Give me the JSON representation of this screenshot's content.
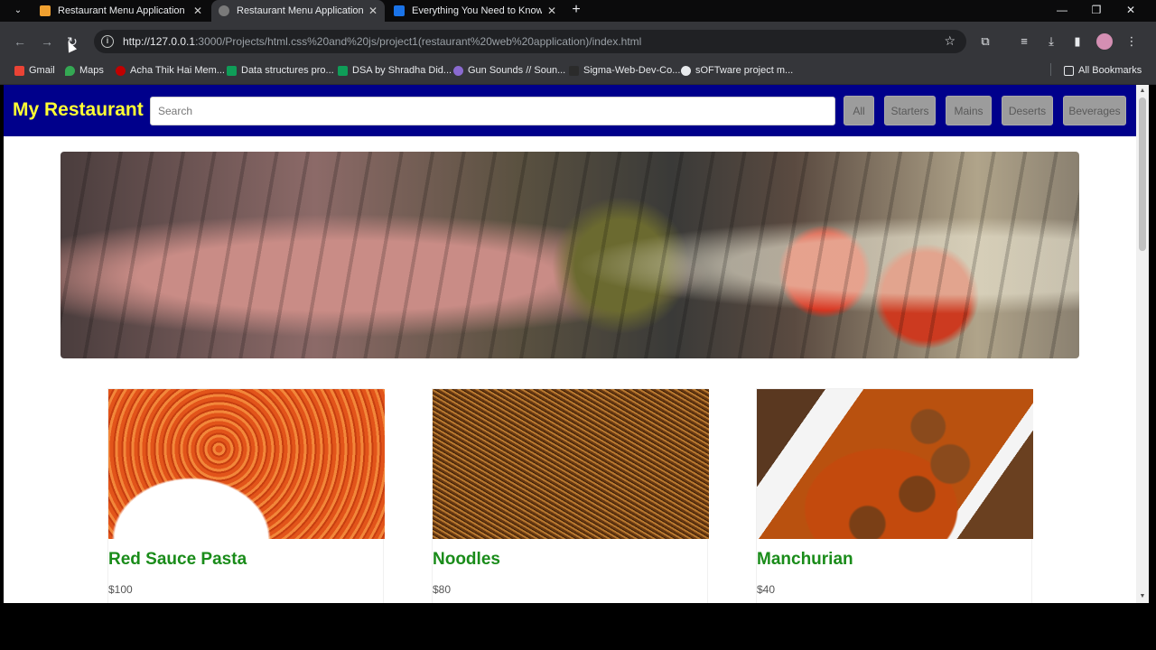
{
  "browser": {
    "tabs": [
      {
        "title": "Restaurant Menu Application -",
        "favicon_color": "#f0a030",
        "active": false
      },
      {
        "title": "Restaurant Menu Application",
        "favicon_color": "#7a7a7a",
        "active": true
      },
      {
        "title": "Everything You Need to Know /",
        "favicon_color": "#1a73e8",
        "active": false
      }
    ],
    "new_tab_label": "+",
    "url_host": "http://127.0.0.1",
    "url_rest": ":3000/Projects/html.css%20and%20js/project1(restaurant%20web%20application)/index.html",
    "bookmarks": [
      {
        "label": "Gmail",
        "color": "#ea4335"
      },
      {
        "label": "Maps",
        "color": "#34a853"
      },
      {
        "label": "Acha Thik Hai Mem...",
        "color": "#c00000"
      },
      {
        "label": "Data structures pro...",
        "color": "#0f9d58"
      },
      {
        "label": "DSA by Shradha Did...",
        "color": "#0f9d58"
      },
      {
        "label": "Gun Sounds // Soun...",
        "color": "#8a6ad0"
      },
      {
        "label": "Sigma-Web-Dev-Co...",
        "color": "#2b2b2b"
      },
      {
        "label": "sOFTware project m...",
        "color": "#e8eaed"
      }
    ],
    "all_bookmarks": "All Bookmarks"
  },
  "site": {
    "brand": "My Restaurant",
    "search_placeholder": "Search",
    "filters": [
      "All",
      "Starters",
      "Mains",
      "Deserts",
      "Beverages"
    ]
  },
  "menu": [
    {
      "name": "Red Sauce Pasta",
      "price": "$100"
    },
    {
      "name": "Noodles",
      "price": "$80"
    },
    {
      "name": "Manchurian",
      "price": "$40"
    }
  ],
  "colors": {
    "nav_bg": "#00008b",
    "brand": "#ffff33",
    "item_name": "#1a8c1a"
  }
}
